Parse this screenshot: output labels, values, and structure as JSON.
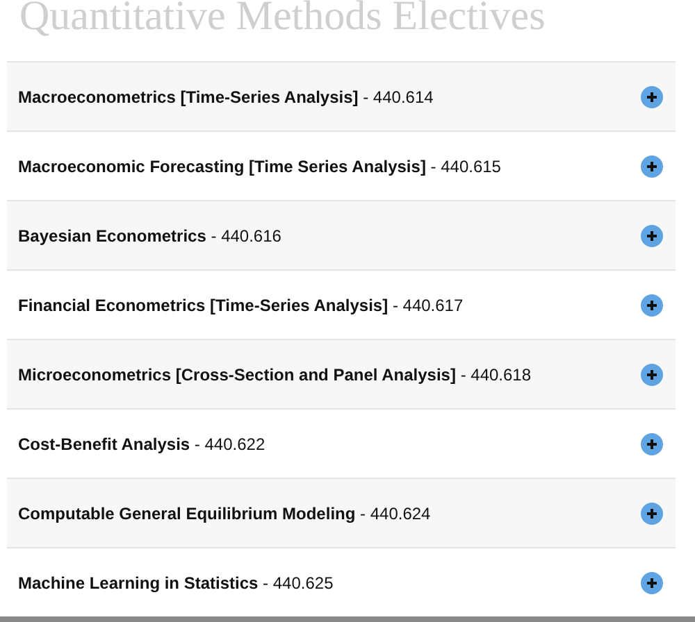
{
  "title": "Quantitative Methods Electives",
  "courses": [
    {
      "label": "**Macroeconometrics [Time-Series Analysis]** - 440.614",
      "expanded": false
    },
    {
      "label": "**Macroeconomic Forecasting [Time Series Analysis]** - 440.615",
      "expanded": false
    },
    {
      "label": "**Bayesian Econometrics** - 440.616",
      "expanded": false
    },
    {
      "label": "**Financial Econometrics [Time-Series Analysis]** - 440.617",
      "expanded": false
    },
    {
      "label": "**Microeconometrics [Cross-Section and Panel Analysis]** - 440.618",
      "expanded": false
    },
    {
      "label": "**Cost-Benefit Analysis** - 440.622",
      "expanded": false
    },
    {
      "label": "**Computable General Equilibrium Modeling** - 440.624",
      "expanded": false
    },
    {
      "label": "**Machine Learning in Statistics** - 440.625",
      "expanded": false
    }
  ]
}
